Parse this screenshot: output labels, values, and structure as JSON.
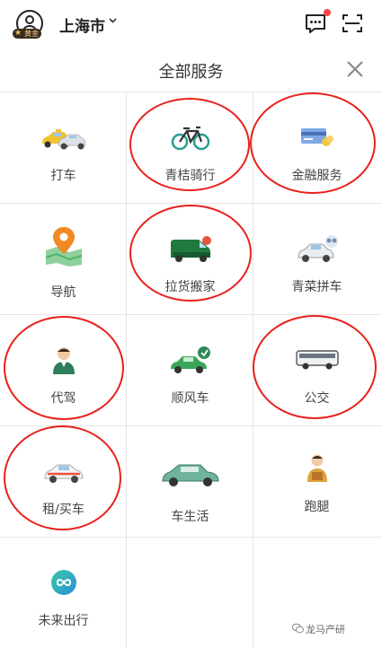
{
  "header": {
    "city": "上海市",
    "member_badge": "黄金",
    "accent_color": "#e8211c"
  },
  "page": {
    "title": "全部服务"
  },
  "services": [
    {
      "label": "打车",
      "icon": "taxi-icon",
      "highlighted": false
    },
    {
      "label": "青桔骑行",
      "icon": "bicycle-icon",
      "highlighted": true
    },
    {
      "label": "金融服务",
      "icon": "finance-card-icon",
      "highlighted": true
    },
    {
      "label": "导航",
      "icon": "map-pin-icon",
      "highlighted": false
    },
    {
      "label": "拉货搬家",
      "icon": "delivery-van-icon",
      "highlighted": true
    },
    {
      "label": "青菜拼车",
      "icon": "carpool-icon",
      "highlighted": false
    },
    {
      "label": "代驾",
      "icon": "chauffeur-icon",
      "highlighted": true
    },
    {
      "label": "顺风车",
      "icon": "hitch-car-icon",
      "highlighted": false
    },
    {
      "label": "公交",
      "icon": "bus-icon",
      "highlighted": true
    },
    {
      "label": "租/买车",
      "icon": "rental-car-icon",
      "highlighted": true
    },
    {
      "label": "车生活",
      "icon": "car-life-icon",
      "highlighted": false
    },
    {
      "label": "跑腿",
      "icon": "errand-icon",
      "highlighted": false
    },
    {
      "label": "未来出行",
      "icon": "future-mobility-icon",
      "highlighted": false
    }
  ],
  "watermark": "龙马产研"
}
